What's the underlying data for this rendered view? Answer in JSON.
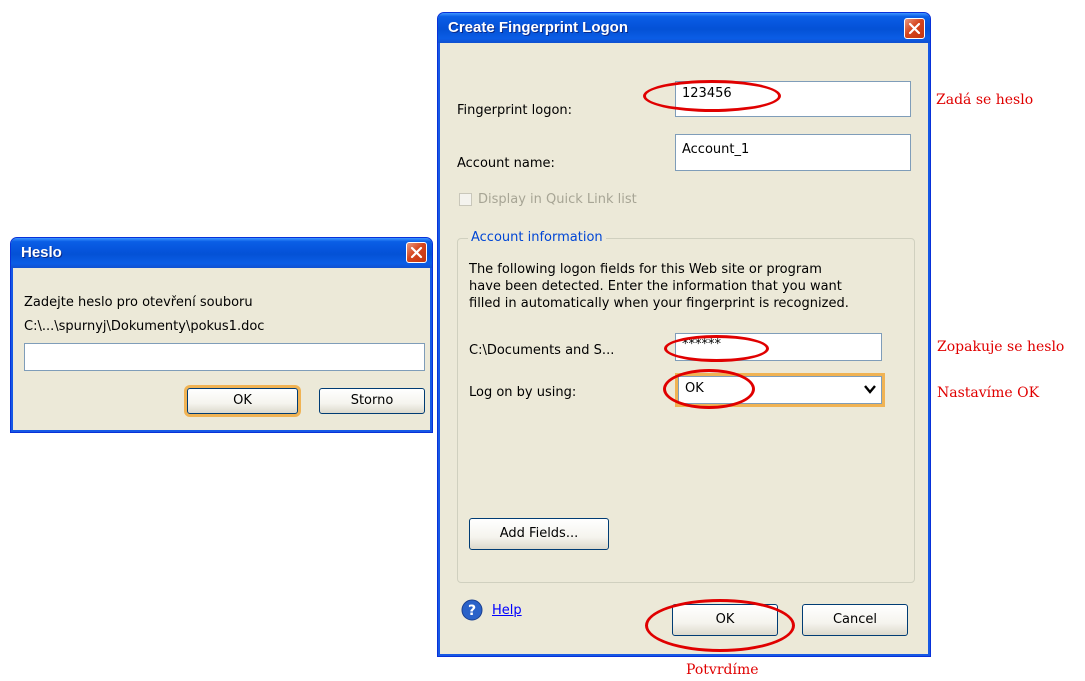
{
  "heslo_dialog": {
    "title": "Heslo",
    "prompt_line1": "Zadejte heslo pro otevření souboru",
    "prompt_line2": "C:\\...\\spurnyj\\Dokumenty\\pokus1.doc",
    "password_value": "",
    "ok_label": "OK",
    "cancel_label": "Storno"
  },
  "fingerprint_dialog": {
    "title": "Create Fingerprint Logon",
    "fingerprint_logon_label": "Fingerprint logon:",
    "fingerprint_logon_value": "123456",
    "account_name_label": "Account name:",
    "account_name_value": "Account_1",
    "quick_link_label": "Display in Quick Link list",
    "quick_link_checked": false,
    "account_info_legend": "Account information",
    "account_info_text_line1": "The following logon fields for this Web site or program",
    "account_info_text_line2": "have been detected. Enter the information that you want",
    "account_info_text_line3": "filled in automatically when your fingerprint is recognized.",
    "path_label": "C:\\Documents and S...",
    "path_value": "******",
    "logon_by_label": "Log on by using:",
    "logon_by_value": "OK",
    "add_fields_label": "Add Fields...",
    "help_label": "Help",
    "ok_label": "OK",
    "cancel_label": "Cancel"
  },
  "annotations": {
    "password_note": "Zadá se heslo",
    "repeat_note": "Zopakuje se heslo",
    "set_ok_note": "Nastavíme OK",
    "confirm_note": "Potvrdíme",
    "color": "#e00000"
  }
}
